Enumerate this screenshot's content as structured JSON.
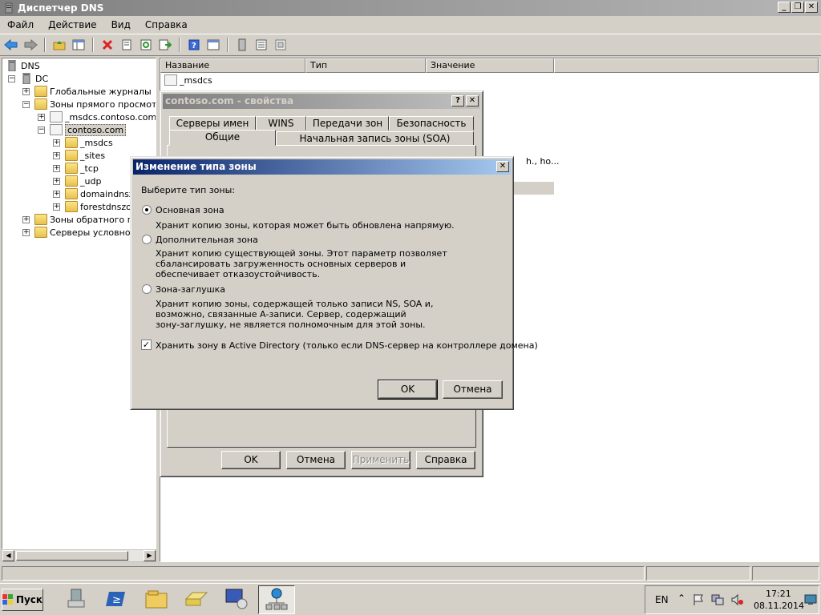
{
  "window": {
    "title": "Диспетчер DNS"
  },
  "menu": [
    "Файл",
    "Действие",
    "Вид",
    "Справка"
  ],
  "tree": [
    {
      "label": "DNS"
    },
    {
      "label": "DC"
    },
    {
      "label": "Глобальные журналы"
    },
    {
      "label": "Зоны прямого просмотра"
    },
    {
      "label": "_msdcs.contoso.com"
    },
    {
      "label": "contoso.com"
    },
    {
      "label": "_msdcs"
    },
    {
      "label": "_sites"
    },
    {
      "label": "_tcp"
    },
    {
      "label": "_udp"
    },
    {
      "label": "domaindnszo"
    },
    {
      "label": "forestdnszor"
    },
    {
      "label": "Зоны обратного пр"
    },
    {
      "label": "Серверы условной"
    }
  ],
  "list": {
    "columns": [
      "Название",
      "Тип",
      "Значение"
    ],
    "rows": [
      {
        "name": "_msdcs"
      }
    ],
    "partial_value": "h., ho..."
  },
  "props_dialog": {
    "title": "contoso.com - свойства",
    "tabs_top": [
      "Серверы имен",
      "WINS",
      "Передачи зон",
      "Безопасность"
    ],
    "tabs_bottom": [
      "Общие",
      "Начальная запись зоны (SOA)"
    ],
    "buttons": {
      "ok": "OK",
      "cancel": "Отмена",
      "apply": "Применить",
      "help": "Справка"
    }
  },
  "zone_dialog": {
    "title": "Изменение типа зоны",
    "prompt": "Выберите тип зоны:",
    "options": [
      {
        "label": "Основная зона",
        "desc": [
          "Хранит копию зоны, которая может быть обновлена напрямую."
        ]
      },
      {
        "label": "Дополнительная зона",
        "desc": [
          "Хранит копию существующей зоны. Этот параметр позволяет",
          "сбалансировать загруженность основных серверов и",
          "обеспечивает отказоустойчивость."
        ]
      },
      {
        "label": "Зона-заглушка",
        "desc": [
          "Хранит копию зоны, содержащей только записи NS, SOA и,",
          "возможно, связанные А-записи. Сервер, содержащий",
          "зону-заглушку, не является полномочным для этой зоны."
        ]
      }
    ],
    "ad_checkbox": "Хранить зону в Active Directory (только если DNS-сервер на контроллере домена)",
    "ok": "OK",
    "cancel": "Отмена"
  },
  "taskbar": {
    "start": "Пуск",
    "lang": "EN",
    "time": "17:21",
    "date": "08.11.2014"
  },
  "colors": {
    "active_title": "#0a246a",
    "inactive_title": "#808080",
    "face": "#d4d0c8"
  }
}
